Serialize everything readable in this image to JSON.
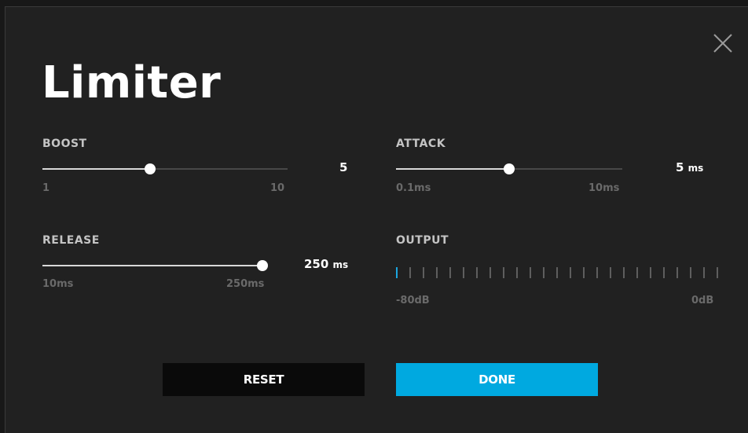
{
  "dialog": {
    "title": "Limiter",
    "close_icon": "close-icon"
  },
  "boost": {
    "label": "BOOST",
    "min_label": "1",
    "max_label": "10",
    "value": "5",
    "unit": "",
    "fraction": 0.44
  },
  "attack": {
    "label": "ATTACK",
    "min_label": "0.1ms",
    "max_label": "10ms",
    "value": "5",
    "unit": "ms",
    "fraction": 0.5
  },
  "release": {
    "label": "RELEASE",
    "min_label": "10ms",
    "max_label": "250ms",
    "value": "250",
    "unit": "ms",
    "fraction": 1.0
  },
  "output": {
    "label": "OUTPUT",
    "min_label": "-80dB",
    "max_label": "0dB",
    "bars_total": 25,
    "bars_active": 1,
    "active_color": "#1ba6e0"
  },
  "buttons": {
    "reset": "RESET",
    "done": "DONE"
  },
  "colors": {
    "accent": "#00a9e0",
    "background": "#212121"
  }
}
